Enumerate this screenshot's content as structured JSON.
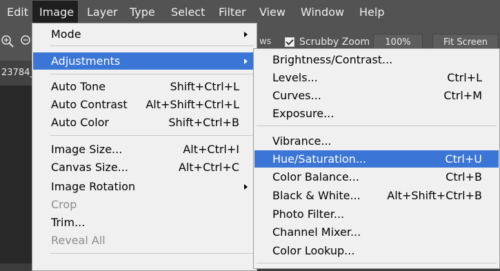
{
  "menubar": {
    "items": [
      "Edit",
      "Image",
      "Layer",
      "Type",
      "Select",
      "Filter",
      "View",
      "Window",
      "Help"
    ]
  },
  "options_bar": {
    "partial_label": "ws",
    "scrubby_zoom": {
      "label": "Scrubby Zoom",
      "checked": true
    },
    "zoom_level": "100%",
    "fit_screen": "Fit Screen"
  },
  "document_tab": {
    "name": "23784_"
  },
  "image_menu": {
    "mode": "Mode",
    "adjustments": "Adjustments",
    "auto_tone": {
      "label": "Auto Tone",
      "shortcut": "Shift+Ctrl+L"
    },
    "auto_contrast": {
      "label": "Auto Contrast",
      "shortcut": "Alt+Shift+Ctrl+L"
    },
    "auto_color": {
      "label": "Auto Color",
      "shortcut": "Shift+Ctrl+B"
    },
    "image_size": {
      "label": "Image Size...",
      "shortcut": "Alt+Ctrl+I"
    },
    "canvas_size": {
      "label": "Canvas Size...",
      "shortcut": "Alt+Ctrl+C"
    },
    "image_rotation": "Image Rotation",
    "crop": "Crop",
    "trim": "Trim...",
    "reveal_all": "Reveal All"
  },
  "adjustments_menu": {
    "brightness_contrast": {
      "label": "Brightness/Contrast...",
      "shortcut": ""
    },
    "levels": {
      "label": "Levels...",
      "shortcut": "Ctrl+L"
    },
    "curves": {
      "label": "Curves...",
      "shortcut": "Ctrl+M"
    },
    "exposure": {
      "label": "Exposure...",
      "shortcut": ""
    },
    "vibrance": {
      "label": "Vibrance...",
      "shortcut": ""
    },
    "hue_saturation": {
      "label": "Hue/Saturation...",
      "shortcut": "Ctrl+U"
    },
    "color_balance": {
      "label": "Color Balance...",
      "shortcut": "Ctrl+B"
    },
    "black_white": {
      "label": "Black & White...",
      "shortcut": "Alt+Shift+Ctrl+B"
    },
    "photo_filter": {
      "label": "Photo Filter...",
      "shortcut": ""
    },
    "channel_mixer": {
      "label": "Channel Mixer...",
      "shortcut": ""
    },
    "color_lookup": {
      "label": "Color Lookup...",
      "shortcut": ""
    }
  },
  "colors": {
    "highlight": "#3b76d6",
    "menu_bg": "#f0f0f0",
    "chrome_bg": "#535353"
  }
}
